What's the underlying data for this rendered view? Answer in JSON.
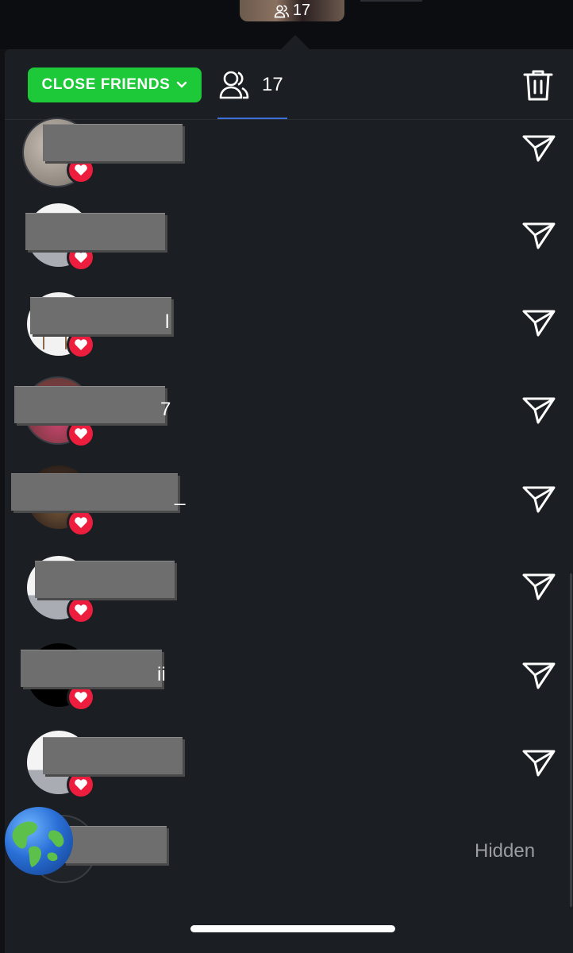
{
  "story": {
    "viewer_count": "17"
  },
  "header": {
    "audience_label": "CLOSE FRIENDS",
    "viewers_count": "17"
  },
  "list": {
    "rows": [
      {
        "name_tail": ""
      },
      {
        "name_tail": ""
      },
      {
        "name_tail": "l"
      },
      {
        "name_tail": "7"
      },
      {
        "name_tail": "_"
      },
      {
        "name_tail": ""
      },
      {
        "name_tail": "ii"
      },
      {
        "name_tail": ""
      }
    ],
    "last_row": {
      "status": "Hidden"
    }
  },
  "colors": {
    "accent_green": "#1ec939",
    "heart_red": "#ec1d3d",
    "background": "#1b1e22",
    "active_tab": "#3d6fd8"
  },
  "icons": {
    "viewers": "people-icon",
    "delete": "trash-icon",
    "send": "paper-plane-icon",
    "badge": "heart-icon",
    "globe": "globe-emoji"
  }
}
